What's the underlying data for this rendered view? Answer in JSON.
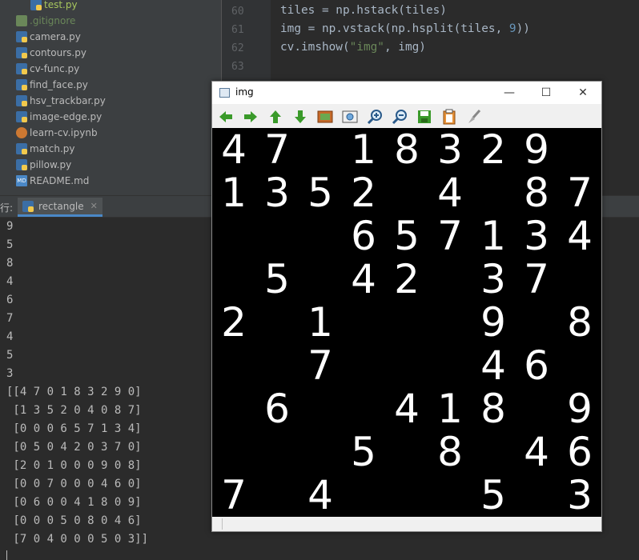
{
  "project": {
    "files": [
      {
        "name": "test.py",
        "type": "py",
        "color": "#a7c65d"
      },
      {
        "name": ".gitignore",
        "type": "git",
        "color": "#6a8759"
      },
      {
        "name": "camera.py",
        "type": "py",
        "color": "#bbbbbb"
      },
      {
        "name": "contours.py",
        "type": "py",
        "color": "#bbbbbb"
      },
      {
        "name": "cv-func.py",
        "type": "py",
        "color": "#bbbbbb"
      },
      {
        "name": "find_face.py",
        "type": "py",
        "color": "#bbbbbb"
      },
      {
        "name": "hsv_trackbar.py",
        "type": "py",
        "color": "#bbbbbb"
      },
      {
        "name": "image-edge.py",
        "type": "py",
        "color": "#bbbbbb"
      },
      {
        "name": "learn-cv.ipynb",
        "type": "nb",
        "color": "#bbbbbb"
      },
      {
        "name": "match.py",
        "type": "py",
        "color": "#bbbbbb"
      },
      {
        "name": "pillow.py",
        "type": "py",
        "color": "#bbbbbb"
      },
      {
        "name": "README.md",
        "type": "md",
        "color": "#bbbbbb"
      }
    ]
  },
  "editor": {
    "lines": [
      {
        "num": "60",
        "code": "tiles = np.hstack(tiles)"
      },
      {
        "num": "61",
        "code": "img = np.vstack(np.hsplit(tiles, 9))"
      },
      {
        "num": "62",
        "code": "cv.imshow(\"img\", img)"
      },
      {
        "num": "63",
        "code": ""
      }
    ]
  },
  "run": {
    "label": "行:",
    "tab_label": "rectangle",
    "close_icon": "close-icon"
  },
  "console": {
    "lines": [
      "9",
      "5",
      "8",
      "4",
      "6",
      "7",
      "4",
      "5",
      "3",
      "[[4 7 0 1 8 3 2 9 0]",
      " [1 3 5 2 0 4 0 8 7]",
      " [0 0 0 6 5 7 1 3 4]",
      " [0 5 0 4 2 0 3 7 0]",
      " [2 0 1 0 0 0 9 0 8]",
      " [0 0 7 0 0 0 4 6 0]",
      " [0 6 0 0 4 1 8 0 9]",
      " [0 0 0 5 0 8 0 4 6]",
      " [7 0 4 0 0 0 5 0 3]]"
    ]
  },
  "img_window": {
    "title": "img",
    "minimize": "—",
    "maximize": "☐",
    "close": "✕",
    "toolbar_icons": [
      "arrow-left-icon",
      "arrow-right-icon",
      "arrow-up-icon",
      "arrow-down-icon",
      "image-icon",
      "zoom-fit-icon",
      "zoom-in-icon",
      "zoom-out-icon",
      "save-icon",
      "copy-icon",
      "brush-icon"
    ],
    "grid": [
      [
        4,
        7,
        0,
        1,
        8,
        3,
        2,
        9,
        0
      ],
      [
        1,
        3,
        5,
        2,
        0,
        4,
        0,
        8,
        7
      ],
      [
        0,
        0,
        0,
        6,
        5,
        7,
        1,
        3,
        4
      ],
      [
        0,
        5,
        0,
        4,
        2,
        0,
        3,
        7,
        0
      ],
      [
        2,
        0,
        1,
        0,
        0,
        0,
        9,
        0,
        8
      ],
      [
        0,
        0,
        7,
        0,
        0,
        0,
        4,
        6,
        0
      ],
      [
        0,
        6,
        0,
        0,
        4,
        1,
        8,
        0,
        9
      ],
      [
        0,
        0,
        0,
        5,
        0,
        8,
        0,
        4,
        6
      ],
      [
        7,
        0,
        4,
        0,
        0,
        0,
        5,
        0,
        3
      ]
    ]
  },
  "colors": {
    "ide_bg": "#2b2b2b",
    "panel_bg": "#3c3f41",
    "code_text": "#a9b7c6",
    "string": "#6a8759",
    "number": "#6897bb"
  }
}
